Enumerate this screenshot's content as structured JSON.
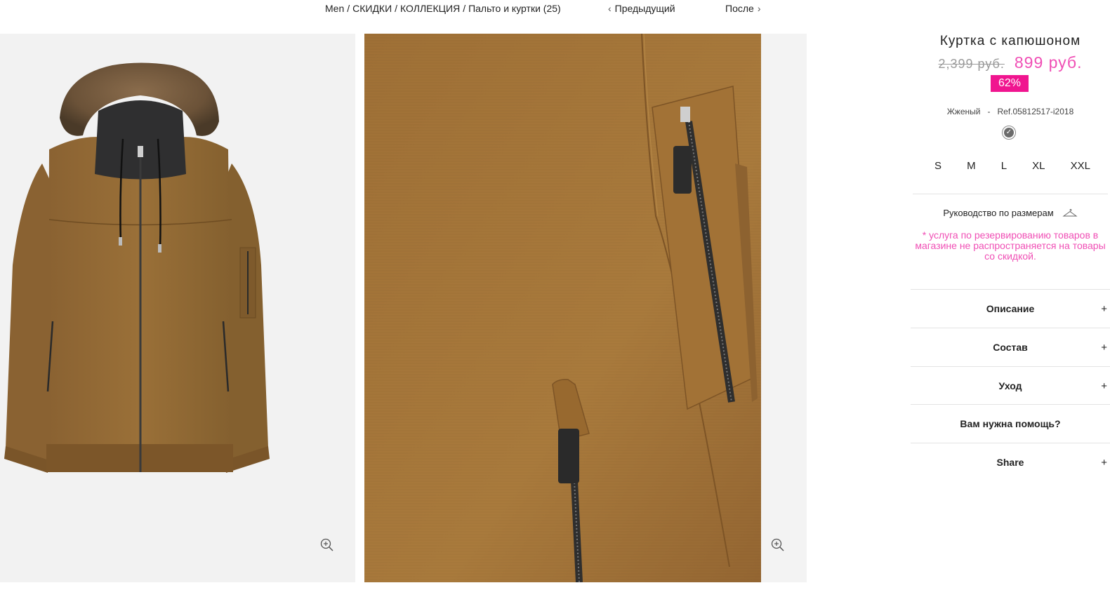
{
  "breadcrumb": {
    "items": [
      "Men",
      "СКИДКИ",
      "КОЛЛЕКЦИЯ",
      "Пальто и куртки (25)"
    ],
    "separator": "/"
  },
  "nav": {
    "prev_label": "Предыдущий",
    "next_label": "После"
  },
  "product": {
    "title": "Куртка с капюшоном",
    "old_price": "2,399 руб.",
    "new_price": "899 руб.",
    "discount_badge": "62%",
    "color_name": "Жженый",
    "meta_separator": "-",
    "ref": "Ref.05812517-i2018",
    "swatch_icon": "check-icon"
  },
  "sizes": [
    "S",
    "M",
    "L",
    "XL",
    "XXL"
  ],
  "size_guide_label": "Руководство по размерам",
  "notice": "* услуга по резервированию товаров в магазине не распространяется на товары со скидкой.",
  "accordion": [
    {
      "label": "Описание",
      "icon": "+"
    },
    {
      "label": "Состав",
      "icon": "+"
    },
    {
      "label": "Уход",
      "icon": "+"
    },
    {
      "label": "Вам нужна помощь?",
      "icon": ""
    },
    {
      "label": "Share",
      "icon": "+"
    }
  ],
  "colors": {
    "accent_pink": "#f04fb5",
    "badge_pink": "#f0158f",
    "jacket": "#936a35"
  },
  "icons": {
    "zoom": "zoom-in-icon",
    "hanger": "hanger-icon"
  }
}
